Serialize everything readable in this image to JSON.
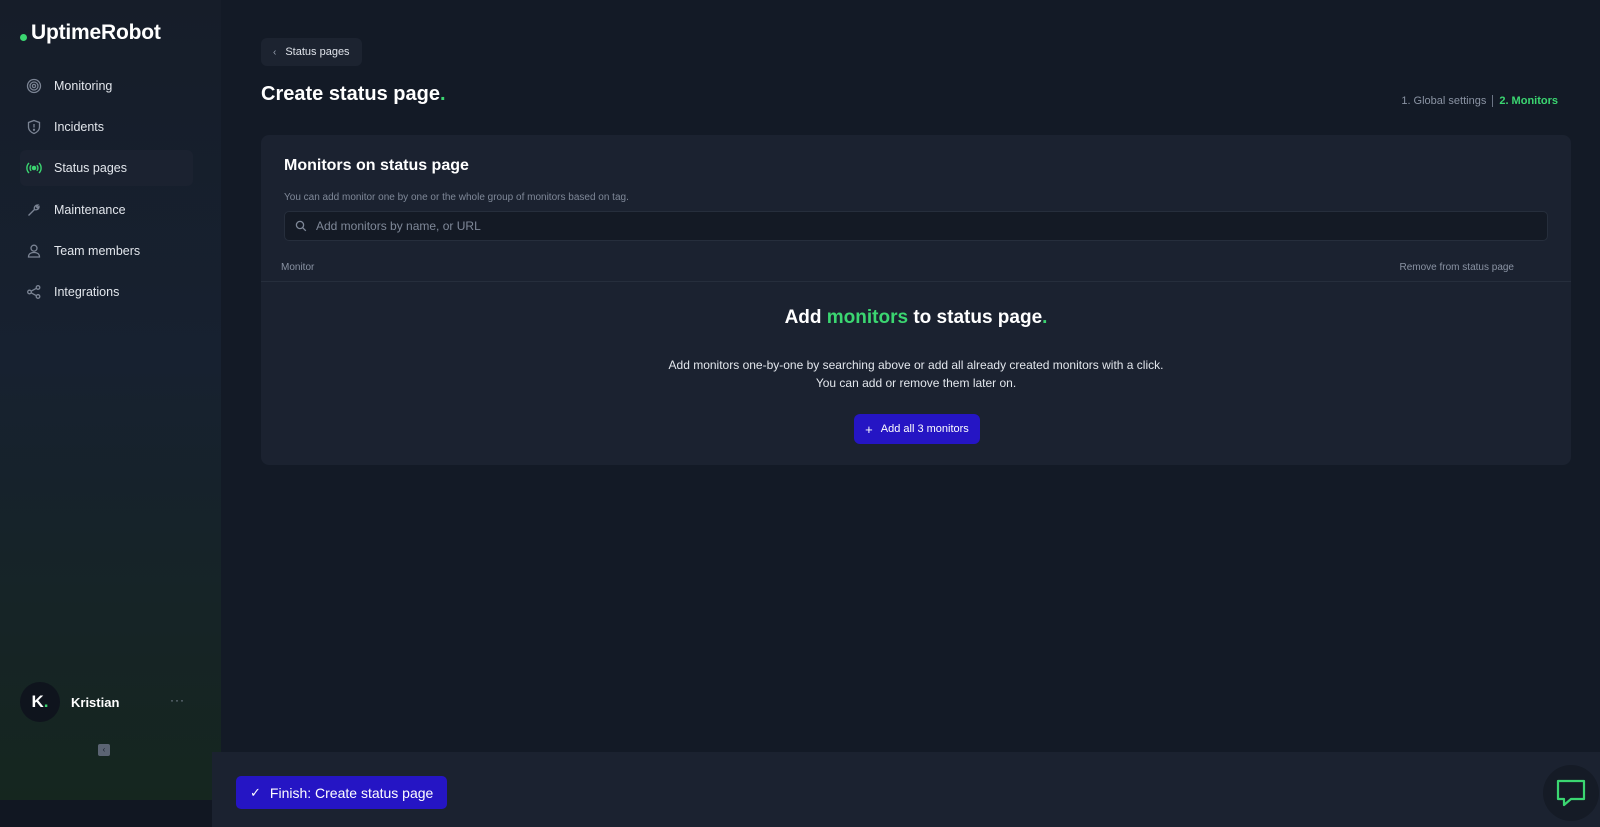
{
  "app": {
    "logo": "UptimeRobot"
  },
  "sidebar": {
    "items": [
      {
        "label": "Monitoring",
        "icon": "target-icon",
        "active": false
      },
      {
        "label": "Incidents",
        "icon": "shield-icon",
        "active": false
      },
      {
        "label": "Status pages",
        "icon": "broadcast-icon",
        "active": true
      },
      {
        "label": "Maintenance",
        "icon": "wrench-icon",
        "active": false
      },
      {
        "label": "Team members",
        "icon": "user-icon",
        "active": false
      },
      {
        "label": "Integrations",
        "icon": "share-icon",
        "active": false
      }
    ],
    "user": {
      "initial": "K",
      "initial_dot": ".",
      "name": "Kristian",
      "more": "···"
    }
  },
  "header": {
    "back_label": "Status pages",
    "title": "Create status page",
    "title_dot": ".",
    "steps": {
      "step1": "1. Global settings",
      "step2": "2. Monitors"
    }
  },
  "card": {
    "title": "Monitors on status page",
    "hint": "You can add monitor one by one or the whole group of monitors based on tag.",
    "search_placeholder": "Add monitors by name, or URL",
    "columns": {
      "monitor": "Monitor",
      "remove": "Remove from status page"
    },
    "empty": {
      "title_a": "Add ",
      "title_b": "monitors",
      "title_c": " to status page",
      "title_dot": ".",
      "line1": "Add monitors one-by-one by searching above or add all already created monitors with a click.",
      "line2": "You can add or remove them later on."
    },
    "add_all_label": "Add all 3 monitors"
  },
  "footer": {
    "finish_label": "Finish: Create status page"
  },
  "colors": {
    "accent_green": "#3bd671",
    "primary_button": "#2515c4",
    "background": "#131a26",
    "card": "#1b2230"
  }
}
